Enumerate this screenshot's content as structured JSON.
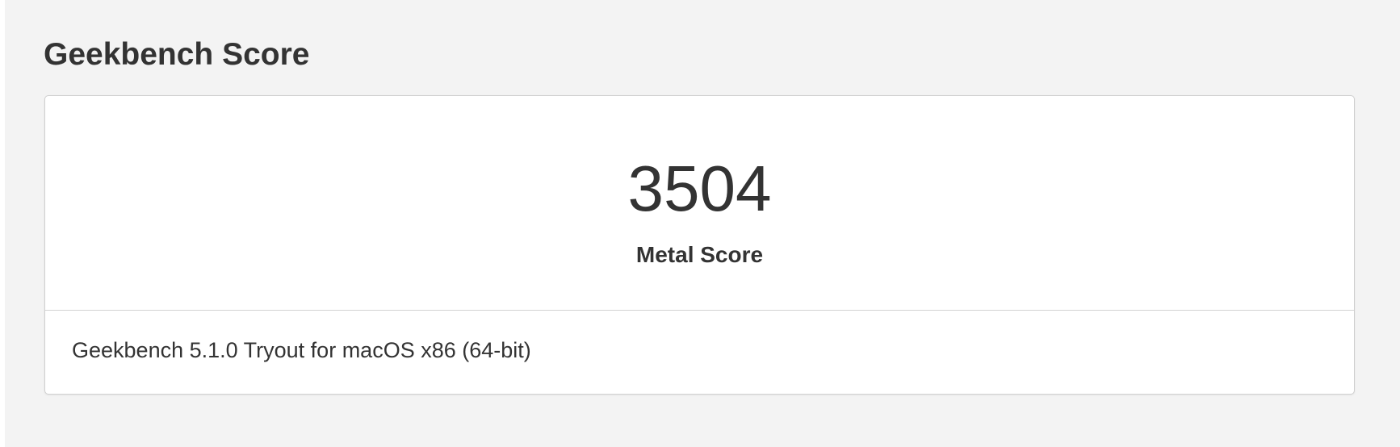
{
  "section": {
    "title": "Geekbench Score"
  },
  "score_card": {
    "score": "3504",
    "score_label": "Metal Score",
    "version": "Geekbench 5.1.0 Tryout for macOS x86 (64-bit)"
  }
}
